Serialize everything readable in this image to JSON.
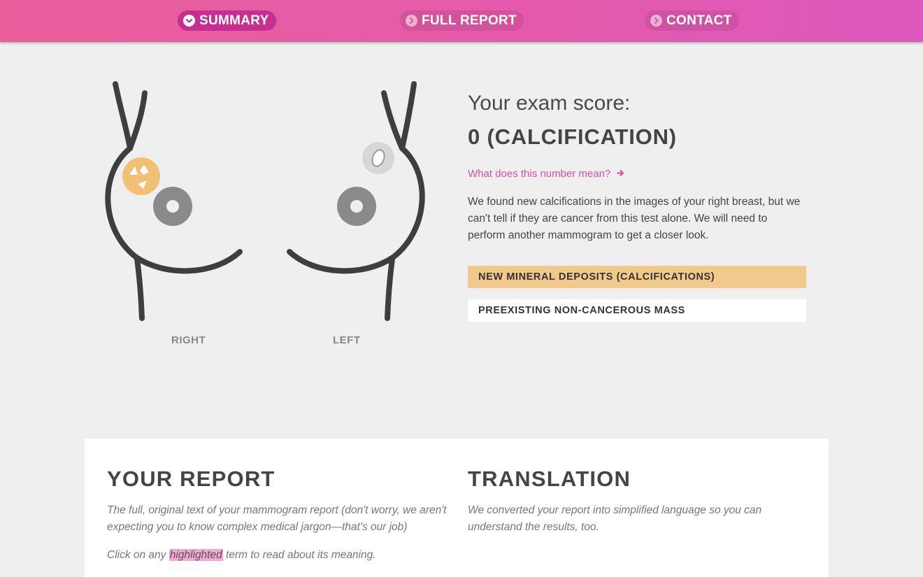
{
  "nav": {
    "items": [
      {
        "label": "SUMMARY",
        "active": true,
        "icon": "chevron-down-circle-icon"
      },
      {
        "label": "FULL REPORT",
        "active": false,
        "icon": "chevron-right-circle-icon"
      },
      {
        "label": "CONTACT",
        "active": false,
        "icon": "chevron-right-circle-icon"
      }
    ]
  },
  "illustration": {
    "right_label": "RIGHT",
    "left_label": "LEFT",
    "calcification_color": "#f1c074",
    "mass_color": "#d7d7d7"
  },
  "score": {
    "heading": "Your exam score:",
    "value": "0 (CALCIFICATION)",
    "meaning_link": "What does this number mean?",
    "description": "We found new calcifications in the images of your right breast, but we can't tell if they are cancer from this test alone. We will need to perform another mammogram to get a closer look.",
    "findings": [
      {
        "label": "NEW MINERAL DEPOSITS (CALCIFICATIONS)",
        "color": "#f1c98c"
      },
      {
        "label": "PREEXISTING NON-CANCEROUS MASS",
        "color": "#ffffff"
      }
    ]
  },
  "report": {
    "title": "YOUR REPORT",
    "intro": "The full, original text of your mammogram report (don't worry, we aren't expecting you to know complex medical jargon—that's our job)",
    "click_prefix": "Click on any",
    "click_highlight": "highlighted",
    "click_suffix": "term to read about its meaning."
  },
  "translation": {
    "title": "TRANSLATION",
    "intro": "We converted your report into simplified language so you can understand the results, too."
  },
  "colors": {
    "accent": "#e14aa8",
    "nav_active": "#c72e92",
    "outline": "#3f3d3e",
    "nipple": "#8b8a8b"
  }
}
